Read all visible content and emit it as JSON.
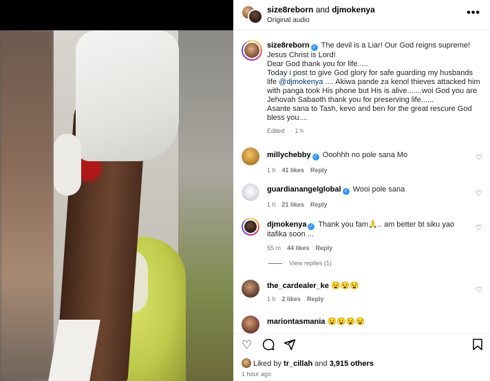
{
  "header": {
    "user1": "size8reborn",
    "and_text": " and ",
    "user2": "djmokenya",
    "audio": "Original audio",
    "more": "•••"
  },
  "caption": {
    "username": "size8reborn",
    "text_1": "The devil is a Liar! Our God reigns supreme! Jesus Christ is Lord!",
    "text_2": "Dear God thank you for life.....",
    "text_3a": "Today i post to give God glory for safe guarding my husbands life ",
    "mention": "@djmokenya",
    "text_3b": " .... Akiwa pande za kenol thieves attacked him with panga took His phone but His is alive.......woi God you are Jehovah Sabaoth thank you for preserving life......",
    "text_4": "Asante sana to Tash, kevo and ben for the great rescure God bless you....",
    "edited": "Edited",
    "time": "1 h"
  },
  "comments": [
    {
      "username": "millychebby",
      "text": "Ooohhh no pole sana Mo",
      "time": "1 h",
      "likes": "41 likes",
      "reply": "Reply"
    },
    {
      "username": "guardianangelglobal",
      "text": "Wooi pole sana",
      "time": "1 h",
      "likes": "21 likes",
      "reply": "Reply"
    },
    {
      "username": "djmokenya",
      "text": "Thank you fam🙏.. am better bt siku yao itafika soon ...",
      "time": "55 m",
      "likes": "44 likes",
      "reply": "Reply",
      "view_replies": "View replies (1)"
    },
    {
      "username": "the_cardealer_ke",
      "text": "😧😧😧",
      "time": "1 h",
      "likes": "2 likes",
      "reply": "Reply"
    },
    {
      "username": "mariontasmania",
      "text": "😧😧😧😧",
      "time": "",
      "likes": "",
      "reply": ""
    }
  ],
  "footer": {
    "liked_prefix": "Liked by ",
    "liked_user": "tr_cillah",
    "liked_mid": " and ",
    "liked_count": "3,915 others",
    "time_ago": "1 hour ago"
  },
  "icons": {
    "heart": "heart-icon",
    "comment": "comment-icon",
    "share": "share-icon",
    "save": "bookmark-icon",
    "verified": "verified-badge-icon"
  },
  "colors": {
    "verified": "#3897f0",
    "mention": "#00376b",
    "meta": "#737373"
  }
}
